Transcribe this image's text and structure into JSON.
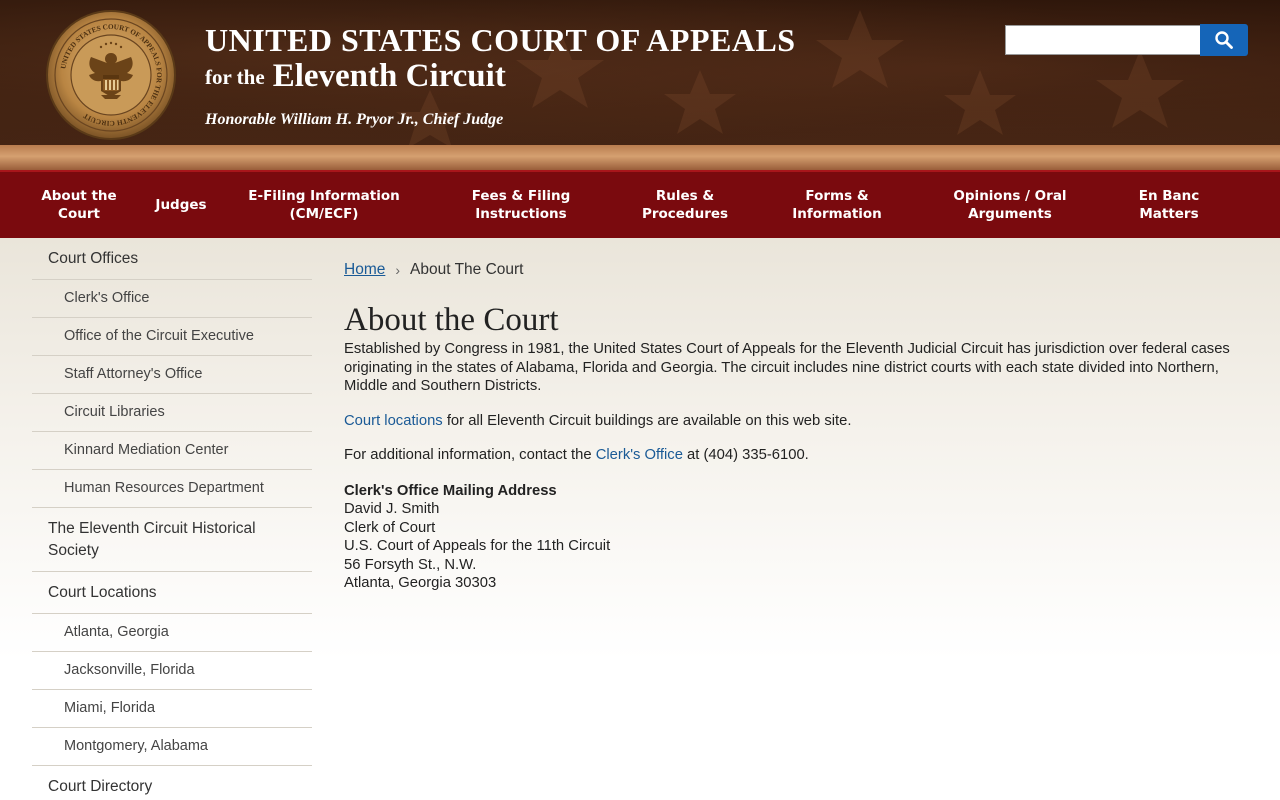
{
  "header": {
    "title_line1": "UNITED STATES COURT OF APPEALS",
    "title_for": "for the",
    "title_circuit": "Eleventh Circuit",
    "chief_judge": "Honorable William H. Pryor Jr., Chief Judge",
    "seal_text": "UNITED STATES COURT OF APPEALS FOR THE ELEVENTH CIRCUIT",
    "search_placeholder": ""
  },
  "nav": [
    {
      "label": "About the\nCourt"
    },
    {
      "label": "Judges"
    },
    {
      "label": "E-Filing Information\n(CM/ECF)"
    },
    {
      "label": "Fees & Filing\nInstructions"
    },
    {
      "label": "Rules &\nProcedures"
    },
    {
      "label": "Forms &\nInformation"
    },
    {
      "label": "Opinions / Oral\nArguments"
    },
    {
      "label": "En Banc\nMatters"
    }
  ],
  "sidebar": [
    {
      "label": "Court Offices",
      "level": 1
    },
    {
      "label": "Clerk's Office",
      "level": 2
    },
    {
      "label": "Office of the Circuit Executive",
      "level": 2
    },
    {
      "label": "Staff Attorney's Office",
      "level": 2
    },
    {
      "label": "Circuit Libraries",
      "level": 2
    },
    {
      "label": "Kinnard Mediation Center",
      "level": 2
    },
    {
      "label": "Human Resources Department",
      "level": 2
    },
    {
      "label": "The Eleventh Circuit Historical Society",
      "level": 1
    },
    {
      "label": "Court Locations",
      "level": 1
    },
    {
      "label": "Atlanta, Georgia",
      "level": 2
    },
    {
      "label": "Jacksonville, Florida",
      "level": 2
    },
    {
      "label": "Miami, Florida",
      "level": 2
    },
    {
      "label": "Montgomery, Alabama",
      "level": 2
    },
    {
      "label": "Court Directory",
      "level": 1
    }
  ],
  "breadcrumb": {
    "home": "Home",
    "current": "About The Court"
  },
  "page": {
    "title": "About the Court",
    "intro": "Established by Congress in 1981, the United States Court of Appeals for the Eleventh Judicial Circuit has jurisdiction over federal cases originating in the states of Alabama, Florida and Georgia. The circuit includes nine district courts with each state divided into Northern, Middle and Southern Districts.",
    "locations_link": "Court locations",
    "locations_rest": " for all Eleventh Circuit buildings are available on this web site.",
    "contact_pre": "For additional information, contact the ",
    "contact_link": "Clerk's Office",
    "contact_post": " at (404) 335-6100.",
    "address": {
      "heading": "Clerk's Office Mailing Address",
      "lines": [
        "David J. Smith",
        "Clerk of Court",
        "U.S. Court of Appeals for the 11th Circuit",
        "56 Forsyth St., N.W.",
        "Atlanta, Georgia 30303"
      ]
    }
  },
  "colors": {
    "nav_bg": "#7a0a0e",
    "link": "#1a5a96",
    "search_button": "#1565b8",
    "header_dark": "#2a1409"
  }
}
